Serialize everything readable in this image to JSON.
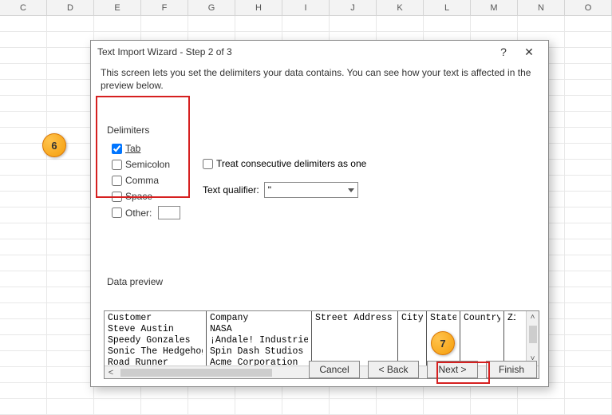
{
  "columns": [
    "C",
    "D",
    "E",
    "F",
    "G",
    "H",
    "I",
    "J",
    "K",
    "L",
    "M",
    "N",
    "O"
  ],
  "dialog": {
    "title": "Text Import Wizard - Step 2 of 3",
    "help": "?",
    "close": "✕",
    "description": "This screen lets you set the delimiters your data contains.  You can see how your text is affected in the preview below.",
    "delimiters_legend": "Delimiters",
    "delimiters": {
      "tab": {
        "label": "Tab",
        "checked": true
      },
      "semicolon": {
        "label": "Semicolon",
        "checked": false
      },
      "comma": {
        "label": "Comma",
        "checked": false
      },
      "space": {
        "label": "Space",
        "checked": false
      },
      "other": {
        "label": "Other:",
        "checked": false,
        "value": ""
      }
    },
    "treat_consecutive": {
      "label": "Treat consecutive delimiters as one",
      "checked": false
    },
    "qualifier_label": "Text qualifier:",
    "qualifier_value": "\"",
    "preview_label": "Data preview",
    "preview": {
      "headers": [
        "Customer",
        "Company",
        "Street Address",
        "City",
        "State",
        "Country",
        "Zi"
      ],
      "rows": [
        [
          "Steve Austin",
          "NASA",
          "",
          "",
          "",
          "",
          ""
        ],
        [
          "Speedy Gonzales",
          "¡Ándale! Industries",
          "",
          "",
          "",
          "",
          ""
        ],
        [
          "Sonic The Hedgehog",
          "Spin Dash Studios",
          "",
          "",
          "",
          "",
          ""
        ],
        [
          "Road Runner",
          "Acme Corporation",
          "",
          "",
          "",
          "",
          ""
        ]
      ]
    },
    "buttons": {
      "cancel": "Cancel",
      "back": "< Back",
      "next": "Next >",
      "finish": "Finish"
    }
  },
  "callouts": {
    "six": "6",
    "seven": "7"
  }
}
